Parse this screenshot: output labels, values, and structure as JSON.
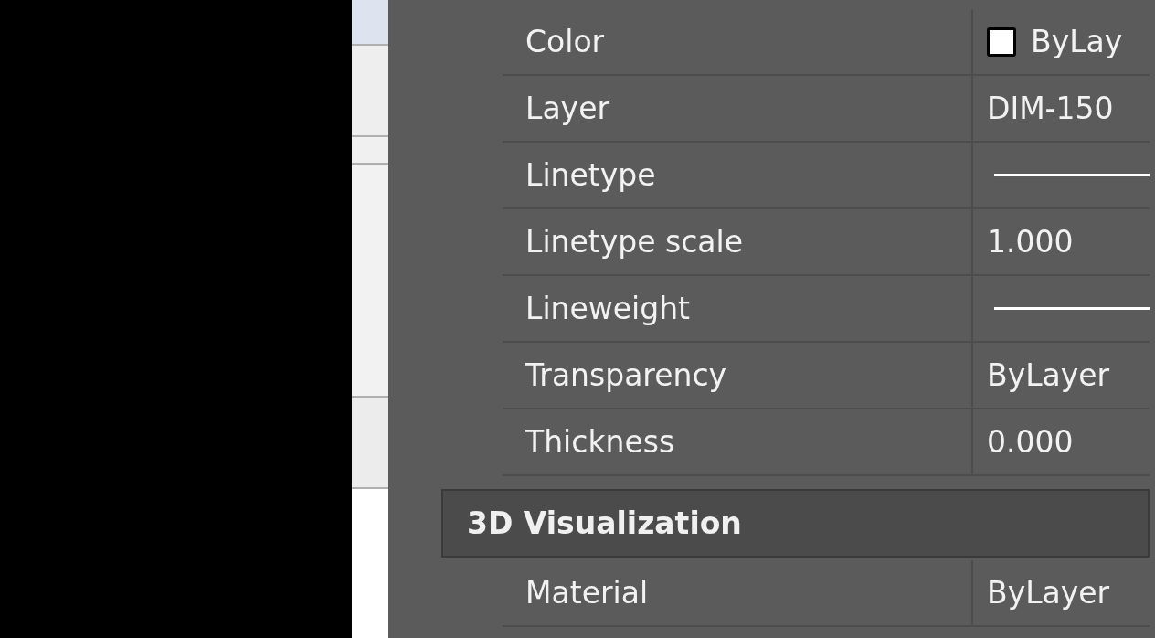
{
  "properties": [
    {
      "label": "Color",
      "kind": "swatch",
      "value": "ByLay"
    },
    {
      "label": "Layer",
      "kind": "text",
      "value": "DIM-150"
    },
    {
      "label": "Linetype",
      "kind": "line"
    },
    {
      "label": "Linetype scale",
      "kind": "text",
      "value": "1.000"
    },
    {
      "label": "Lineweight",
      "kind": "line"
    },
    {
      "label": "Transparency",
      "kind": "text",
      "value": "ByLayer"
    },
    {
      "label": "Thickness",
      "kind": "text",
      "value": "0.000"
    }
  ],
  "section": {
    "title": "3D Visualization",
    "properties": [
      {
        "label": "Material",
        "kind": "text",
        "value": "ByLayer"
      }
    ]
  }
}
